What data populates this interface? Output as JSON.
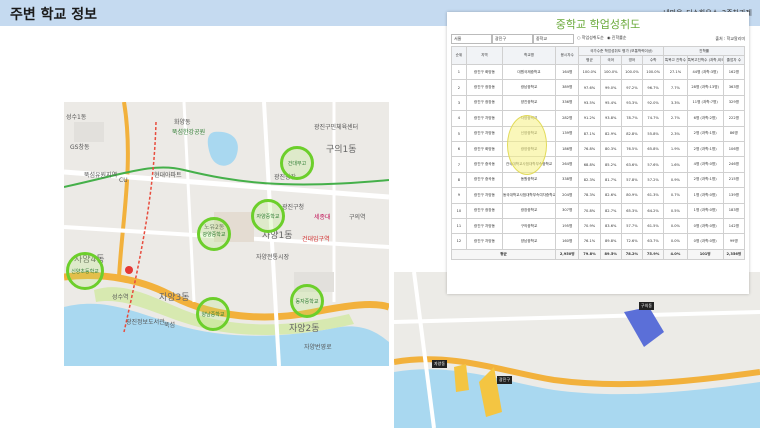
{
  "header": {
    "title": "주변 학교 정보",
    "subtitle": "내마음_디스하우스_3주차과제"
  },
  "left_map": {
    "labels": [
      "성수1동",
      "GS창동",
      "뚝섬유원지역",
      "화양동",
      "뚝섬한강공원",
      "CU",
      "현대아파트",
      "성수역",
      "자양1동",
      "구의1동",
      "광진구청",
      "광진광장",
      "건대입구역",
      "자양전통시장",
      "노유2동",
      "자양3동",
      "자양4동",
      "자양2동",
      "자양번영로",
      "뚝섬",
      "광진정보도서관",
      "세종대",
      "구의역",
      "광진구민체육센터"
    ],
    "schools": [
      "건대부고",
      "자양중학교",
      "광양중학교",
      "양남중학교",
      "신양초등학교",
      "동자중학교",
      "양진중학교",
      "광진중학교"
    ]
  },
  "right_map": {
    "markers": [
      "자양동",
      "광진구",
      "구의동"
    ]
  },
  "panel": {
    "title": "중학교 학업성취도",
    "filters": {
      "city": "서울",
      "district": "광진구",
      "type": "중학교"
    },
    "radio_options": [
      "학업성취도순",
      "진학률순"
    ],
    "source": "출처 : 학교알리미",
    "group_headers": {
      "achievement": "국가수준 학업성취도 평가 (보통학력이상)",
      "advance": "진학률"
    },
    "headers": [
      "순위",
      "지역",
      "학교명",
      "응시자수",
      "평균",
      "국어",
      "영어",
      "수학",
      "특목고 진학수",
      "특목고진학수 (과학,외국어,국제고)",
      "졸업자 수"
    ],
    "rows": [
      [
        "1",
        "광진구 화양동",
        "대원국제중학교",
        "164명",
        "100.0%",
        "100.0%",
        "100.0%",
        "100.0%",
        "27.1%",
        "44명 (과학:3명)",
        "162명"
      ],
      [
        "2",
        "광진구 광장동",
        "광남중학교",
        "389명",
        "97.6%",
        "99.0%",
        "97.2%",
        "96.7%",
        "7.7%",
        "28명 (과학:13명)",
        "363명"
      ],
      [
        "3",
        "광진구 광장동",
        "양진중학교",
        "336명",
        "93.5%",
        "95.4%",
        "93.3%",
        "92.0%",
        "3.3%",
        "11명 (과학:7명)",
        "329명"
      ],
      [
        "4",
        "광진구 자양동",
        "자양중학교",
        "282명",
        "91.2%",
        "93.8%",
        "78.7%",
        "74.7%",
        "2.7%",
        "6명 (과학:2명)",
        "222명"
      ],
      [
        "5",
        "광진구 자양동",
        "신양중학교",
        "139명",
        "87.1%",
        "82.9%",
        "82.8%",
        "55.8%",
        "2.3%",
        "2명 (과학:1명)",
        "86명"
      ],
      [
        "6",
        "광진구 화양동",
        "광양중학교",
        "186명",
        "76.8%",
        "80.3%",
        "76.5%",
        "65.8%",
        "1.9%",
        "2명 (과학:1명)",
        "106명"
      ],
      [
        "7",
        "광진구 중곡동",
        "건국대학교사범대학부속중학교",
        "264명",
        "68.8%",
        "85.2%",
        "63.6%",
        "57.6%",
        "1.6%",
        "4명 (과학:0명)",
        "246명"
      ],
      [
        "8",
        "광진구 중곡동",
        "동원중학교",
        "338명",
        "82.3%",
        "81.7%",
        "57.8%",
        "57.2%",
        "0.9%",
        "2명 (과학:1명)",
        "215명"
      ],
      [
        "9",
        "광진구 자양동",
        "동국대학교사범대학부속여자중학교",
        "204명",
        "78.3%",
        "82.6%",
        "80.9%",
        "61.3%",
        "0.7%",
        "1명 (과학:0명)",
        "139명"
      ],
      [
        "10",
        "광진구 광장동",
        "광장중학교",
        "307명",
        "70.8%",
        "82.7%",
        "65.3%",
        "64.2%",
        "0.5%",
        "1명 (과학:0명)",
        "183명"
      ],
      [
        "11",
        "광진구 자양동",
        "구의중학교",
        "195명",
        "70.9%",
        "83.6%",
        "57.7%",
        "61.5%",
        "0.0%",
        "0명 (과학:0명)",
        "142명"
      ],
      [
        "12",
        "광진구 자양동",
        "양남중학교",
        "160명",
        "76.1%",
        "89.8%",
        "72.6%",
        "63.7%",
        "0.0%",
        "0명 (과학:0명)",
        "99명"
      ]
    ],
    "footer": [
      "평균",
      "2,950명",
      "79.8%",
      "89.5%",
      "78.2%",
      "75.9%",
      "4.0%",
      "101명",
      "2,356명"
    ]
  }
}
